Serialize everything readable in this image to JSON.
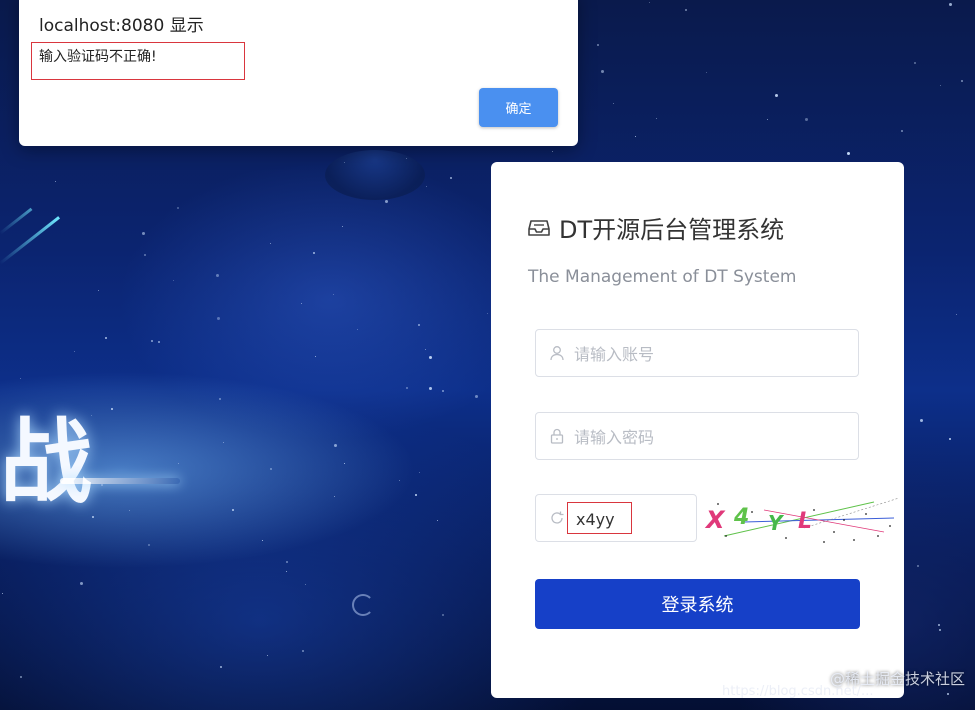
{
  "alert": {
    "title": "localhost:8080 显示",
    "message": "输入验证码不正确!",
    "ok_label": "确定"
  },
  "login": {
    "title": "DT开源后台管理系统",
    "subtitle": "The Management of DT System",
    "username_placeholder": "请输入账号",
    "password_placeholder": "请输入密码",
    "code_value": "x4yy",
    "captcha_text": [
      "X",
      "4",
      "Y",
      "L"
    ],
    "captcha_colors": [
      "#e0397a",
      "#5fc24a",
      "#46b84a",
      "#e0397a"
    ],
    "submit_label": "登录系统",
    "accent_color": "#1640c8"
  },
  "background": {
    "slogan_glyph": "战"
  },
  "watermark": {
    "text": "@稀土掘金技术社区",
    "url": "https://blog.csdn.net/..."
  }
}
